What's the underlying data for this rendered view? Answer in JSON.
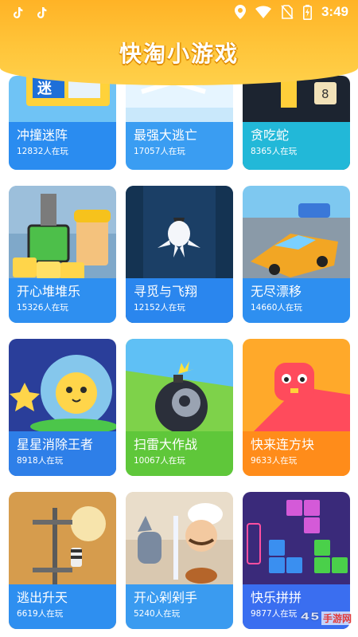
{
  "status_bar": {
    "time": "3:49",
    "icons": [
      "tiktok-icon",
      "tiktok-icon",
      "location-icon",
      "wifi-icon",
      "no-sim-icon",
      "battery-charging-icon"
    ]
  },
  "header": {
    "title": "快淘小游戏"
  },
  "games": [
    {
      "name": "冲撞迷阵",
      "players": "12832人在玩",
      "color": "#2a8cf0"
    },
    {
      "name": "最强大逃亡",
      "players": "17057人在玩",
      "color": "#3a9df2"
    },
    {
      "name": "贪吃蛇",
      "players": "8365人在玩",
      "color": "#22b8d8"
    },
    {
      "name": "开心堆堆乐",
      "players": "15326人在玩",
      "color": "#2e8ff0"
    },
    {
      "name": "寻觅与飞翔",
      "players": "12152人在玩",
      "color": "#2a86ee"
    },
    {
      "name": "无尽漂移",
      "players": "14660人在玩",
      "color": "#2e8ff0"
    },
    {
      "name": "星星消除王者",
      "players": "8918人在玩",
      "color": "#2e7fe8"
    },
    {
      "name": "扫雷大作战",
      "players": "10067人在玩",
      "color": "#5fc73a"
    },
    {
      "name": "快来连方块",
      "players": "9633人在玩",
      "color": "#ff8c1a"
    },
    {
      "name": "逃出升天",
      "players": "6619人在玩",
      "color": "#2e8ff0"
    },
    {
      "name": "开心剁剁手",
      "players": "5240人在玩",
      "color": "#3a9bf0"
    },
    {
      "name": "快乐拼拼",
      "players": "9877人在玩",
      "color": "#3a6ef0"
    }
  ],
  "watermark": {
    "text": "手游网"
  }
}
